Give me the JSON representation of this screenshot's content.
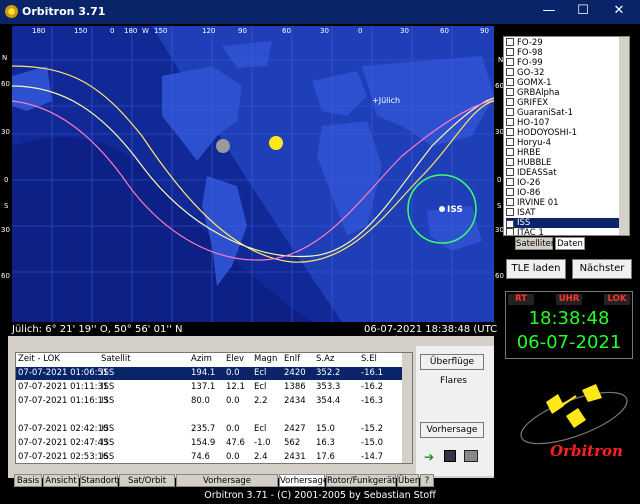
{
  "window": {
    "title": "Orbitron 3.71",
    "minimize": "—",
    "maximize": "☐",
    "close": "✕"
  },
  "map": {
    "top_ticks": [
      "180",
      "150",
      "0",
      "180",
      "W",
      "150",
      "120",
      "90",
      "60",
      "30",
      "0",
      "30",
      "60",
      "90"
    ],
    "left_ticks": [
      "90",
      "N",
      "60",
      "30",
      "0",
      "S",
      "30",
      "60",
      "S"
    ],
    "right_ticks": [
      "N",
      "60",
      "30",
      "0",
      "S",
      "30",
      "60"
    ],
    "observer_label": "+Jülich",
    "sat_label": "ISS"
  },
  "status": {
    "coords": "Jülich: 6° 21' 19'' O, 50° 56' 01'' N",
    "datetime": "06-07-2021 18:38:48 (UTC +2:00)"
  },
  "satellites": [
    {
      "name": "FO-29",
      "checked": false
    },
    {
      "name": "FO-98",
      "checked": false
    },
    {
      "name": "FO-99",
      "checked": false
    },
    {
      "name": "GO-32",
      "checked": false
    },
    {
      "name": "GOMX-1",
      "checked": false
    },
    {
      "name": "GRBAlpha",
      "checked": false
    },
    {
      "name": "GRIFEX",
      "checked": false
    },
    {
      "name": "GuaraniSat-1",
      "checked": false
    },
    {
      "name": "HO-107",
      "checked": false
    },
    {
      "name": "HODOYOSHI-1",
      "checked": false
    },
    {
      "name": "Horyu-4",
      "checked": false
    },
    {
      "name": "HRBE",
      "checked": false
    },
    {
      "name": "HUBBLE",
      "checked": false
    },
    {
      "name": "IDEASSat",
      "checked": false
    },
    {
      "name": "IO-26",
      "checked": false
    },
    {
      "name": "IO-86",
      "checked": false
    },
    {
      "name": "IRVINE 01",
      "checked": false
    },
    {
      "name": "ISAT",
      "checked": false
    },
    {
      "name": "ISS",
      "checked": true,
      "selected": true
    },
    {
      "name": "ITAC 1",
      "checked": false
    }
  ],
  "list_tabs": [
    "Satelliten",
    "Daten"
  ],
  "buttons": {
    "tle_load": "TLE laden",
    "next": "Nächster"
  },
  "clock": {
    "rt": "RT",
    "uhr": "UHR",
    "lok": "LOK",
    "time": "18:38:48",
    "date": "06-07-2021"
  },
  "logo": "Orbitron",
  "pass_table": {
    "headers": [
      "Zeit - LOK",
      "Satellit",
      "Azim",
      "Elev",
      "Magn",
      "Enlf",
      "S.Az",
      "S.El"
    ],
    "rows": [
      [
        "07-07-2021 01:06:51",
        "ISS",
        "194.1",
        "0.0",
        "Ecl",
        "2420",
        "352.2",
        "-16.1"
      ],
      [
        "07-07-2021 01:11:31",
        "ISS",
        "137.1",
        "12.1",
        "Ecl",
        "1386",
        "353.3",
        "-16.2"
      ],
      [
        "07-07-2021 01:16:13",
        "ISS",
        "80.0",
        "0.0",
        "2.2",
        "2434",
        "354.4",
        "-16.3"
      ],
      [
        "",
        "",
        "",
        "",
        "",
        "",
        "",
        ""
      ],
      [
        "07-07-2021 02:42:10",
        "ISS",
        "235.7",
        "0.0",
        "Ecl",
        "2427",
        "15.0",
        "-15.2"
      ],
      [
        "07-07-2021 02:47:43",
        "ISS",
        "154.9",
        "47.6",
        "-1.0",
        "562",
        "16.3",
        "-15.0"
      ],
      [
        "07-07-2021 02:53:16",
        "ISS",
        "74.6",
        "0.0",
        "2.4",
        "2431",
        "17.6",
        "-14.7"
      ]
    ]
  },
  "side_controls": {
    "flyover": "Überflüge",
    "flares": "Flares",
    "forecast": "Vorhersage"
  },
  "bottom_tabs": [
    "Basis",
    "Ansicht",
    "Standort",
    "Sat/Orbit Info",
    "Vorhersage Einstellungen",
    "Vorhersage",
    "Rotor/Funkgerät",
    "Über",
    "?"
  ],
  "footer": "Orbitron 3.71 - (C) 2001-2005 by Sebastian Stoff",
  "colors": {
    "map_day": "#1f3fb8",
    "map_night": "#0a1a7a",
    "orbit": "#ffe36a",
    "coverage": "#3cff6a",
    "clock": "#24ff24"
  }
}
